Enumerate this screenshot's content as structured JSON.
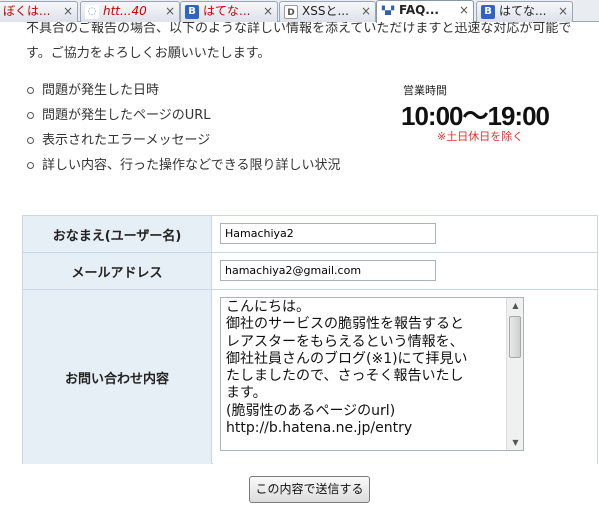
{
  "tabs": [
    {
      "title": "ぼくは...",
      "icon": "generic-page-icon",
      "active": false
    },
    {
      "title": "htt...40",
      "icon": "network-page-icon",
      "active": false
    },
    {
      "title": "はてな...",
      "icon": "hatena-b-icon",
      "active": false
    },
    {
      "title": "XSSと...",
      "icon": "d-page-icon",
      "active": false
    },
    {
      "title": "FAQ...",
      "icon": "faq-icon",
      "active": true
    },
    {
      "title": "はてな...",
      "icon": "hatena-b-icon",
      "active": false
    }
  ],
  "tab_close_glyph": "×",
  "intro": {
    "text": "不具合のご報告の場合、以下のような詳しい情報を添えていただけますと迅速な対応が可能です。ご協力をよろしくお願いいたします。"
  },
  "checklist": [
    "問題が発生した日時",
    "問題が発生したページのURL",
    "表示されたエラーメッセージ",
    "詳しい内容、行った操作などできる限り詳しい状況"
  ],
  "hours": {
    "label": "営業時間",
    "time": "10:00～19:00",
    "note": "※土日休日を除く"
  },
  "form": {
    "name_label": "おなまえ(ユーザー名)",
    "name_value": "Hamachiya2",
    "email_label": "メールアドレス",
    "email_value": "hamachiya2@gmail.com",
    "message_label": "お問い合わせ内容",
    "message_value": "こんにちは。\n御社のサービスの脆弱性を報告すると\nレアスターをもらえるという情報を、\n御社社員さんのブログ(※1)にて拝見い\nたしましたので、さっそく報告いたし\nます。\n(脆弱性のあるページのurl)\nhttp://b.hatena.ne.jp/entry",
    "submit_label": "この内容で送信する"
  },
  "colors": {
    "note_red": "#e03030",
    "table_header_bg": "#e6eef6",
    "table_border": "#c9d7e3"
  }
}
